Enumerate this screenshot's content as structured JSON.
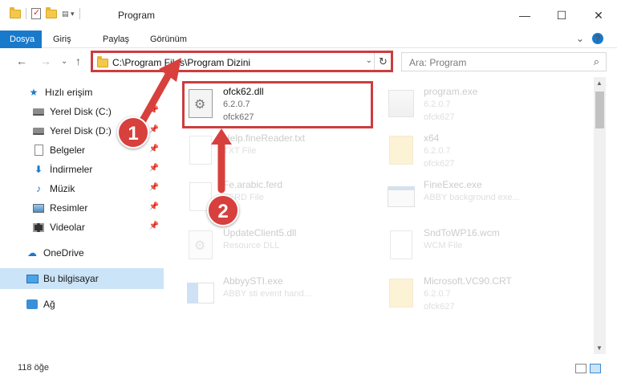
{
  "window": {
    "title": "Program",
    "controls": [
      "minimize-icon",
      "maximize-icon",
      "close-icon"
    ]
  },
  "ribbon": {
    "tabs": [
      {
        "label": "Dosya",
        "active": true
      },
      {
        "label": "Giriş",
        "active": false
      },
      {
        "label": "Paylaş",
        "active": false
      },
      {
        "label": "Görünüm",
        "active": false
      }
    ]
  },
  "address": {
    "path": "C:\\Program Files\\Program Dizini",
    "search_placeholder": "Ara: Program"
  },
  "sidebar": {
    "items": [
      {
        "label": "Hızlı erişim",
        "icon": "star-icon",
        "pinned": false
      },
      {
        "label": "Yerel Disk (C:)",
        "icon": "disk-icon",
        "pinned": true
      },
      {
        "label": "Yerel Disk (D:)",
        "icon": "disk-icon",
        "pinned": true
      },
      {
        "label": "Belgeler",
        "icon": "document-icon",
        "pinned": true
      },
      {
        "label": "İndirmeler",
        "icon": "download-icon",
        "pinned": true
      },
      {
        "label": "Müzik",
        "icon": "music-icon",
        "pinned": true
      },
      {
        "label": "Resimler",
        "icon": "picture-icon",
        "pinned": true
      },
      {
        "label": "Videolar",
        "icon": "video-icon",
        "pinned": true
      },
      {
        "label": "OneDrive",
        "icon": "cloud-icon",
        "pinned": false
      },
      {
        "label": "Bu bilgisayar",
        "icon": "computer-icon",
        "pinned": false,
        "selected": true
      },
      {
        "label": "Ağ",
        "icon": "network-icon",
        "pinned": false
      }
    ]
  },
  "files": [
    {
      "name": "ofck62.dll",
      "line2": "6.2.0.7",
      "line3": "ofck627",
      "icon": "dll-icon",
      "highlighted": true
    },
    {
      "name": "program.exe",
      "line2": "6.2.0.7",
      "line3": "ofck627",
      "icon": "program-icon"
    },
    {
      "name": "Help.fineReader.txt",
      "line2": "TXT File",
      "line3": "",
      "icon": "text-file-icon"
    },
    {
      "name": "x64",
      "line2": "6.2.0.7",
      "line3": "ofck627",
      "icon": "folder-icon"
    },
    {
      "name": "Fe.arabic.ferd",
      "line2": "FERD File",
      "line3": "",
      "icon": "text-file-icon"
    },
    {
      "name": "FineExec.exe",
      "line2": "ABBY background exe...",
      "line3": "",
      "icon": "exe-icon"
    },
    {
      "name": "UpdateClient5.dll",
      "line2": "Resource DLL",
      "line3": "",
      "icon": "dll-icon"
    },
    {
      "name": "SndToWP16.wcm",
      "line2": "WCM File",
      "line3": "",
      "icon": "text-file-icon"
    },
    {
      "name": "AbbyySTI.exe",
      "line2": "ABBY sti event hand...",
      "line3": "",
      "icon": "exe-icon"
    },
    {
      "name": "Microsoft.VC90.CRT",
      "line2": "6.2.0.7",
      "line3": "ofck627",
      "icon": "folder-icon"
    }
  ],
  "status": {
    "item_count": "118 öğe"
  },
  "annotations": {
    "step1": "1",
    "step2": "2",
    "accent_color": "#d7403c"
  }
}
